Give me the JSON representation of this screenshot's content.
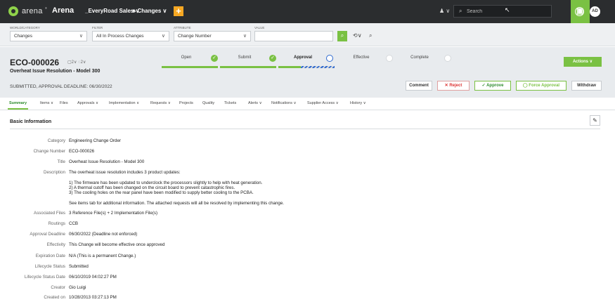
{
  "topbar": {
    "logo_text": "arena",
    "logo_tm": "®",
    "product": "Arena",
    "workspace": "_EveryRoad Sales ∨",
    "changes_menu": "Changes ∨",
    "plus_label": "+",
    "user_filter": "∨",
    "search_placeholder": "Search",
    "avatar": "AD",
    "help": "?"
  },
  "filterbar": {
    "labels": {
      "world_category": "WORLD/CATEGORY",
      "filter": "FILTER",
      "attribute": "ATTRIBUTE",
      "value": "VALUE"
    },
    "world_category": "Changes",
    "filter": "All In Process Changes",
    "attribute": "Change Number",
    "value": ""
  },
  "header": {
    "eco_id": "ECO-000026",
    "badges": "▢2∨   ◌2∨",
    "subtitle": "Overheat Issue Resolution - Model 300",
    "deadline": "SUBMITTED, APPROVAL DEADLINE: 06/30/2022",
    "actions_label": "Actions ∨",
    "stages": [
      {
        "name": "Open",
        "state": "done"
      },
      {
        "name": "Submit",
        "state": "done"
      },
      {
        "name": "Approval",
        "state": "current"
      },
      {
        "name": "Effective",
        "state": "todo"
      },
      {
        "name": "Complete",
        "state": "todo"
      }
    ],
    "buttons": {
      "comment": "Comment",
      "reject": "✕  Reject",
      "approve": "✓  Approve",
      "force_approval": "◯  Force Approval",
      "withdraw": "Withdraw"
    }
  },
  "tabs": [
    {
      "label": "Summary"
    },
    {
      "label": "Items ∨"
    },
    {
      "label": "Files"
    },
    {
      "label": "Approvals ∨"
    },
    {
      "label": "Implementation ∨"
    },
    {
      "label": "Requests ∨"
    },
    {
      "label": "Projects"
    },
    {
      "label": "Quality"
    },
    {
      "label": "Tickets"
    },
    {
      "label": "Alerts ∨"
    },
    {
      "label": "Notifications ∨"
    },
    {
      "label": "Supplier Access ∨"
    },
    {
      "label": "History ∨"
    }
  ],
  "basic": {
    "title": "Basic Information",
    "category": {
      "key": "Category",
      "value": "Engineering Change Order"
    },
    "change_number": {
      "key": "Change Number",
      "value": "ECO-000026"
    },
    "title_field": {
      "key": "Title",
      "value": "Overheat Issue Resolution - Model 300"
    },
    "description": {
      "key": "Description",
      "intro": "The overheat issue resolution includes 3 product updates:",
      "line1": "1) The firmware has been updated to underclock the processors slightly to help with heat generation.",
      "line2": "2) A thermal cutoff has been changed on the circuit board to prevent catastrophic fires.",
      "line3": "3) The cooling holes on the rear panel have been modified to supply better cooling to the PCBA.",
      "outro": "See items tab for additional information. The attached requests will all be resolved by implementing this change."
    },
    "associated_files": {
      "key": "Associated Files",
      "value": "3 Reference File(s) + 2 Implementation File(s)"
    },
    "routings": {
      "key": "Routings",
      "value": "CCB"
    },
    "approval_deadline": {
      "key": "Approval Deadline",
      "value": "06/30/2022 (Deadline not enforced)"
    },
    "effectivity": {
      "key": "Effectivity",
      "value": "This Change will become effective once approved"
    },
    "expiration_date": {
      "key": "Expiration Date",
      "value": "N/A (This is a permanent Change.)"
    },
    "lifecycle_status": {
      "key": "Lifecycle Status",
      "value": "Submitted"
    },
    "lifecycle_status_date": {
      "key": "Lifecycle Status Date",
      "value": "06/10/2019 04:02:27 PM"
    },
    "creator": {
      "key": "Creator",
      "value": "Gio Luigi"
    },
    "created_on": {
      "key": "Created on",
      "value": "10/28/2013 03:27:13 PM"
    }
  },
  "colors": {
    "accent_green": "#7ac143",
    "topbar": "#2b2d2f",
    "plus_orange": "#f7a823",
    "progress_blue": "#2f6ad0"
  }
}
